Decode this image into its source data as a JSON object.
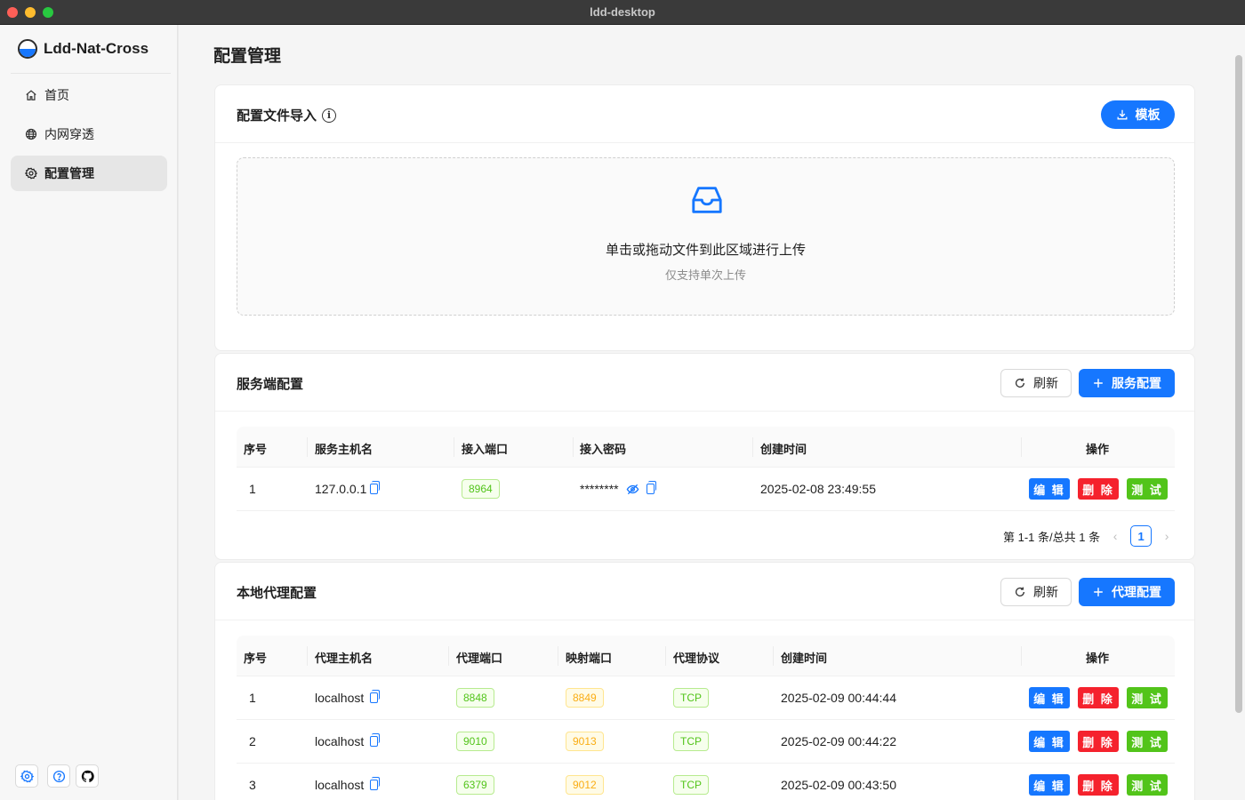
{
  "window": {
    "title": "ldd-desktop"
  },
  "sidebar": {
    "brand": "Ldd-Nat-Cross",
    "items": [
      {
        "label": "首页",
        "icon": "home-icon",
        "active": false
      },
      {
        "label": "内网穿透",
        "icon": "globe-icon",
        "active": false
      },
      {
        "label": "配置管理",
        "icon": "gear-icon",
        "active": true
      }
    ],
    "footer_icons": [
      "settings-icon",
      "help-icon",
      "github-icon"
    ]
  },
  "main": {
    "page_title": "配置管理",
    "import_card": {
      "title": "配置文件导入",
      "info_glyph": "i",
      "template_button": "模板",
      "drop_text": "单击或拖动文件到此区域进行上传",
      "drop_hint": "仅支持单次上传"
    },
    "server_card": {
      "title": "服务端配置",
      "refresh_button": "刷新",
      "add_button": "服务配置",
      "columns": [
        "序号",
        "服务主机名",
        "接入端口",
        "接入密码",
        "创建时间",
        "操作"
      ],
      "rows": [
        {
          "index": "1",
          "host": "127.0.0.1",
          "port": "8964",
          "password": "********",
          "created": "2025-02-08 23:49:55"
        }
      ],
      "pagination": {
        "summary": "第 1-1 条/总共 1 条",
        "current_page": "1",
        "prev": "‹",
        "next": "›"
      }
    },
    "proxy_card": {
      "title": "本地代理配置",
      "refresh_button": "刷新",
      "add_button": "代理配置",
      "columns": [
        "序号",
        "代理主机名",
        "代理端口",
        "映射端口",
        "代理协议",
        "创建时间",
        "操作"
      ],
      "rows": [
        {
          "index": "1",
          "host": "localhost",
          "port": "8848",
          "mapped": "8849",
          "protocol": "TCP",
          "created": "2025-02-09 00:44:44"
        },
        {
          "index": "2",
          "host": "localhost",
          "port": "9010",
          "mapped": "9013",
          "protocol": "TCP",
          "created": "2025-02-09 00:44:22"
        },
        {
          "index": "3",
          "host": "localhost",
          "port": "6379",
          "mapped": "9012",
          "protocol": "TCP",
          "created": "2025-02-09 00:43:50"
        }
      ]
    },
    "actions": {
      "edit": "编 辑",
      "delete": "删 除",
      "test": "测 试"
    }
  },
  "colors": {
    "primary": "#1677ff",
    "danger": "#f5222d",
    "success": "#52c41a",
    "warning": "#faad14"
  }
}
